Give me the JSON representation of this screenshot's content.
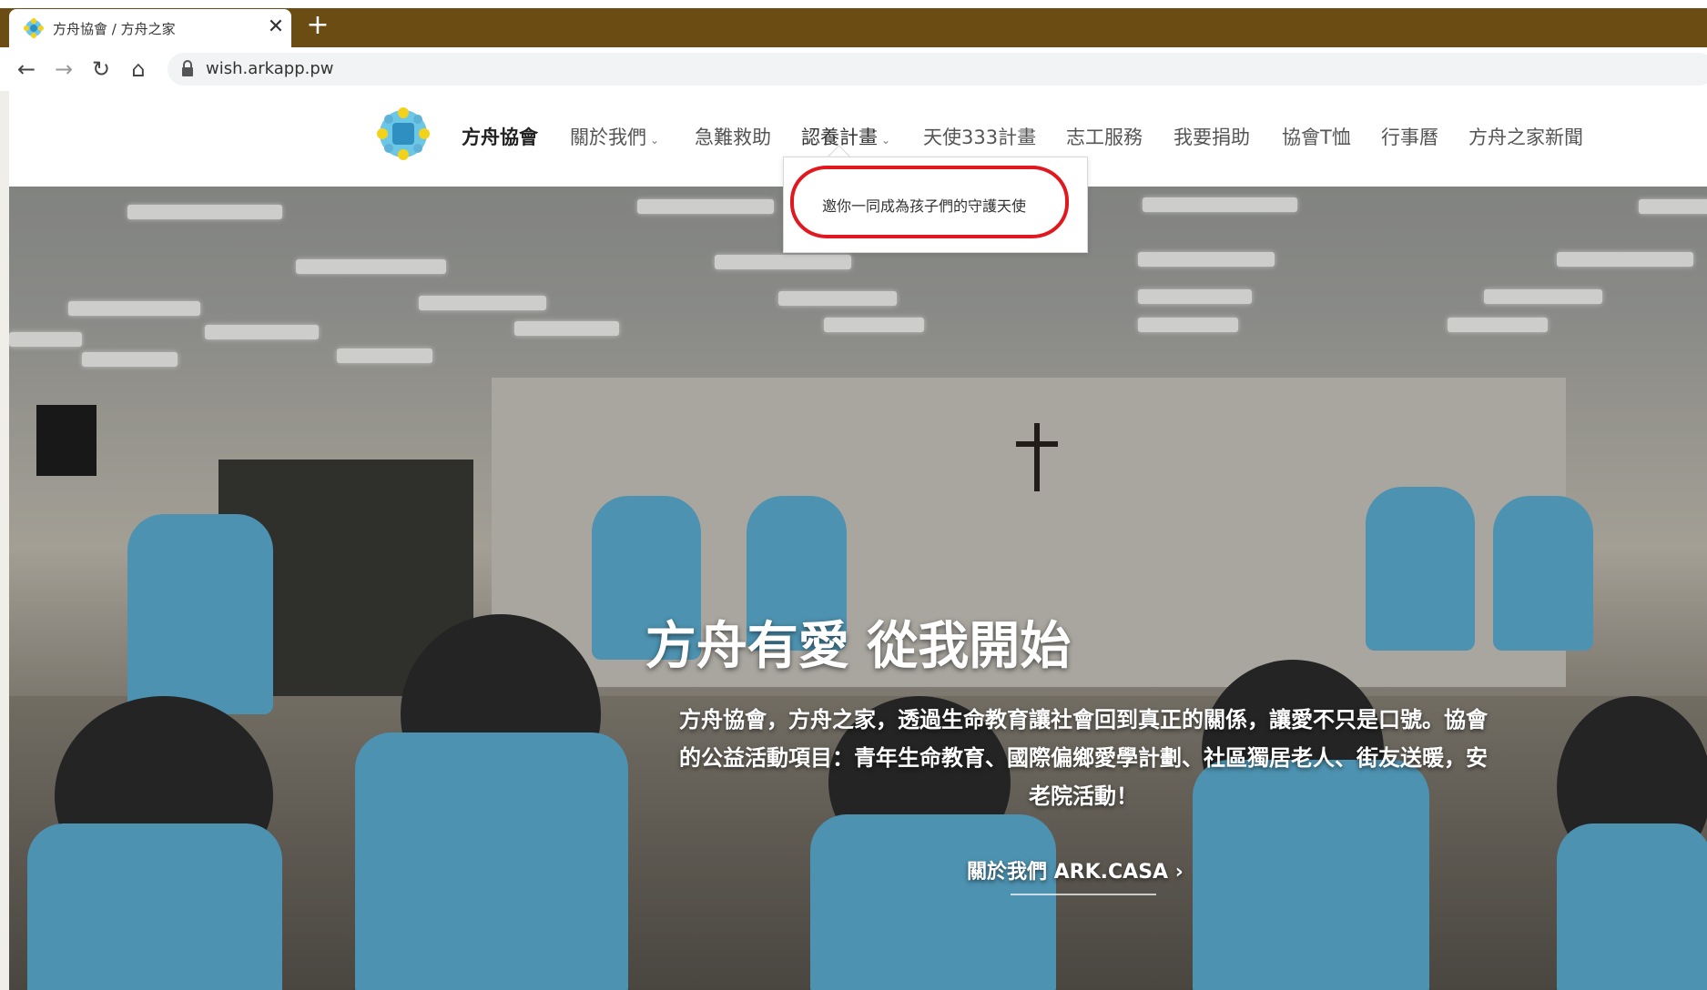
{
  "browser": {
    "tab_title": "方舟協會 / 方舟之家",
    "close_glyph": "✕",
    "newtab_glyph": "+",
    "url": "wish.arkapp.pw",
    "back_glyph": "←",
    "forward_glyph": "→",
    "reload_glyph": "↻",
    "home_glyph": "⌂"
  },
  "nav": {
    "brand": "方舟協會",
    "items": [
      {
        "label": "關於我們",
        "has_caret": true
      },
      {
        "label": "急難救助",
        "has_caret": false
      },
      {
        "label": "認養計畫",
        "has_caret": true
      },
      {
        "label": "天使333計畫",
        "has_caret": false
      },
      {
        "label": "志工服務",
        "has_caret": false
      },
      {
        "label": "我要捐助",
        "has_caret": false
      },
      {
        "label": "協會T恤",
        "has_caret": false
      },
      {
        "label": "行事曆",
        "has_caret": false
      },
      {
        "label": "方舟之家新聞",
        "has_caret": false
      }
    ],
    "caret_glyph": "⌄"
  },
  "dropdown": {
    "item": "邀你一同成為孩子們的守護天使"
  },
  "hero": {
    "title": "方舟有愛 從我開始",
    "description": "方舟協會，方舟之家，透過生命教育讓社會回到真正的關係，讓愛不只是口號。協會的公益活動項目：青年生命教育、國際偏鄉愛學計劃、社區獨居老人、街友送暖，安老院活動！",
    "cta": "關於我們 ARK.CASA  ›"
  },
  "colors": {
    "tabbar": "#6b4d14",
    "annotation": "#e0181f",
    "vest": "#5fb2d7"
  }
}
